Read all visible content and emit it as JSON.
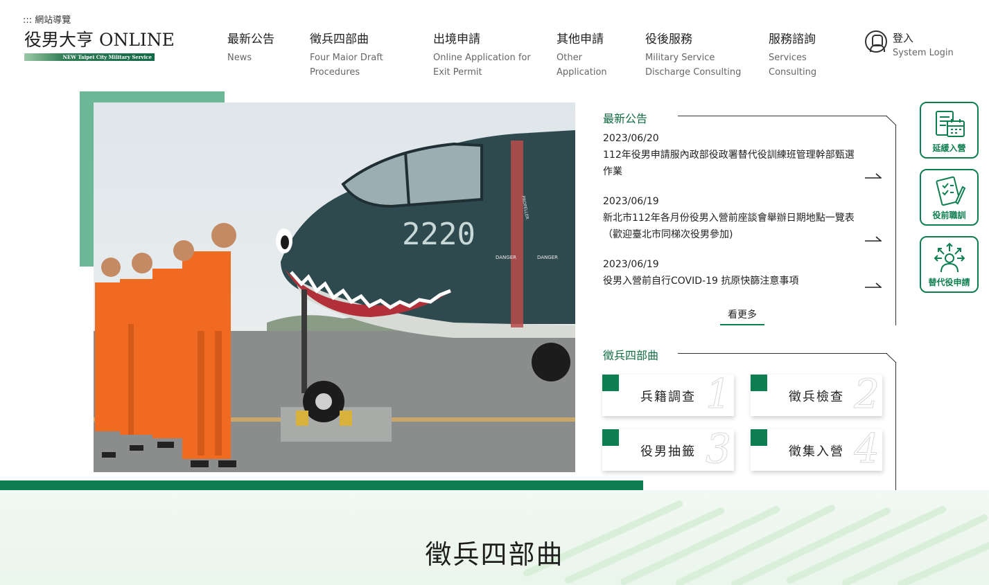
{
  "header": {
    "sitemap": ":::  網站導覽",
    "logo_text": "役男大亨 ONLINE",
    "logo_sub": "NEW Taipei City Military Service",
    "nav": [
      {
        "zh": "最新公告",
        "en": "News"
      },
      {
        "zh": "徵兵四部曲",
        "en": "Four Maior Draft Procedures"
      },
      {
        "zh": "出境申請",
        "en": "Online Application for Exit Permit"
      },
      {
        "zh": "其他申請",
        "en": "Other Application"
      },
      {
        "zh": "役後服務",
        "en": "Military Service Discharge Consulting"
      },
      {
        "zh": "服務諮詢",
        "en": "Services Consulting"
      }
    ],
    "login": {
      "zh": "登入",
      "en": "System Login"
    }
  },
  "news": {
    "title": "最新公告",
    "items": [
      {
        "date": "2023/06/20",
        "title": "112年役男申請服內政部役政署替代役訓練班管理幹部甄選作業"
      },
      {
        "date": "2023/06/19",
        "title": "新北市112年各月份役男入營前座談會舉辦日期地點一覽表（歡迎臺北市同梯次役男參加)"
      },
      {
        "date": "2023/06/19",
        "title": "役男入營前自行COVID-19 抗原快篩注意事項"
      }
    ],
    "more": "看更多"
  },
  "steps": {
    "title": "徵兵四部曲",
    "items": [
      {
        "label": "兵籍調查",
        "num": "1"
      },
      {
        "label": "徵兵檢查",
        "num": "2"
      },
      {
        "label": "役男抽籤",
        "num": "3"
      },
      {
        "label": "徵集入營",
        "num": "4"
      }
    ]
  },
  "quick": [
    {
      "label": "延緩入營",
      "icon": "calendar-document-icon"
    },
    {
      "label": "役前職訓",
      "icon": "checklist-pen-icon"
    },
    {
      "label": "替代役申請",
      "icon": "person-arrows-icon"
    }
  ],
  "hero": {
    "plane_number": "2220",
    "plane_marks": [
      "PROPELLER",
      "DANGER",
      "DANGER"
    ]
  },
  "lower": {
    "title": "徵兵四部曲"
  },
  "colors": {
    "brand_green": "#0d7e4f",
    "accent_green": "#6cb896",
    "title_green": "#0f6b42"
  }
}
